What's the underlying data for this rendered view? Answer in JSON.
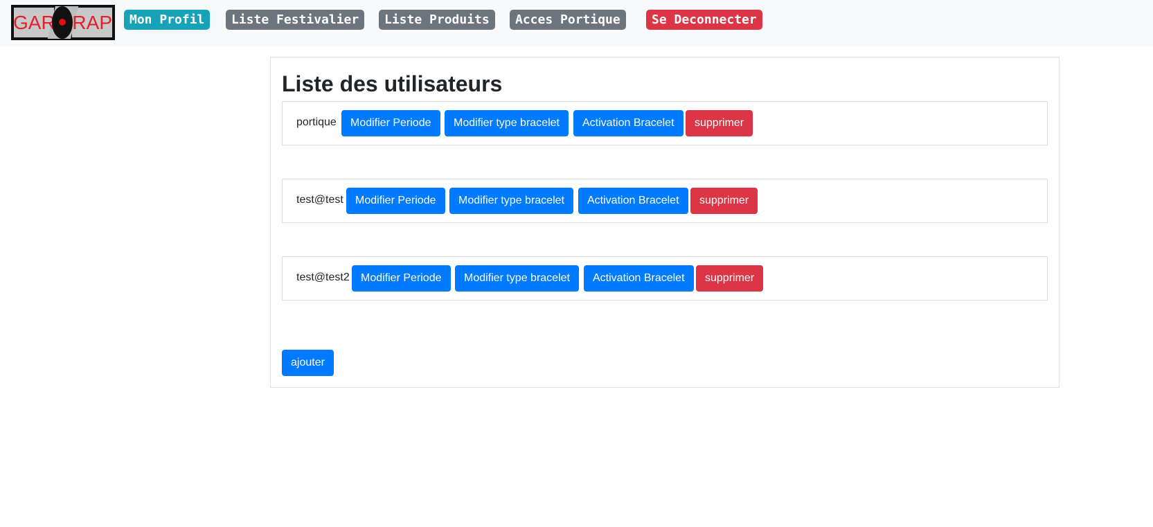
{
  "navbar": {
    "logo": {
      "text_left": "GAR",
      "text_right": "RAP"
    },
    "items": [
      {
        "label": "Mon Profil",
        "style": "info",
        "color": "#17a2b8"
      },
      {
        "label": "Liste Festivalier",
        "style": "secondary",
        "color": "#6c757d"
      },
      {
        "label": "Liste Produits",
        "style": "secondary",
        "color": "#6c757d"
      },
      {
        "label": "Acces Portique",
        "style": "secondary",
        "color": "#6c757d"
      },
      {
        "label": "Se Deconnecter",
        "style": "danger",
        "color": "#dc3545"
      }
    ]
  },
  "main": {
    "title": "Liste des utilisateurs",
    "users": [
      {
        "name": "portique"
      },
      {
        "name": "test@test"
      },
      {
        "name": "test@test2"
      }
    ],
    "actions": {
      "modify_period": "Modifier Periode",
      "modify_bracelet_type": "Modifier type bracelet",
      "activate_bracelet": "Activation Bracelet",
      "delete": "supprimer"
    },
    "add_label": "ajouter"
  },
  "colors": {
    "primary": "#007bff",
    "danger": "#dc3545",
    "info": "#17a2b8",
    "secondary": "#6c757d",
    "navbar_bg": "#f8f9fa"
  }
}
